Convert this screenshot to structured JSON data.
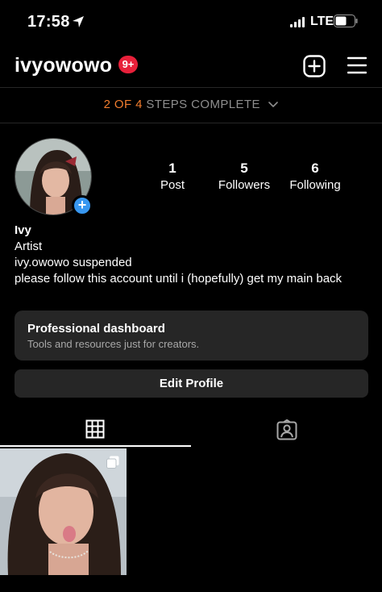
{
  "status_bar": {
    "time": "17:58",
    "network": "LTE"
  },
  "header": {
    "username": "ivyowowo",
    "notifications_badge": "9+"
  },
  "steps": {
    "progress": "2 OF 4",
    "label": "STEPS COMPLETE"
  },
  "stats": [
    {
      "count": "1",
      "label": "Post"
    },
    {
      "count": "5",
      "label": "Followers"
    },
    {
      "count": "6",
      "label": "Following"
    }
  ],
  "bio": {
    "name": "Ivy",
    "category": "Artist",
    "line1": "ivy.owowo suspended",
    "line2": "please follow this account until i (hopefully) get my main back"
  },
  "dashboard": {
    "title": "Professional dashboard",
    "subtitle": "Tools and resources just for creators."
  },
  "edit_profile_label": "Edit Profile",
  "colors": {
    "background": "#000000",
    "surface": "#262626",
    "accent_orange": "#f27d2e",
    "badge_red": "#e8203a",
    "add_blue": "#3897f0"
  },
  "icons": [
    "location-arrow-icon",
    "signal-icon",
    "battery-icon",
    "plus-square-icon",
    "hamburger-menu-icon",
    "chevron-down-icon",
    "grid-icon",
    "tagged-icon",
    "multi-post-icon"
  ]
}
